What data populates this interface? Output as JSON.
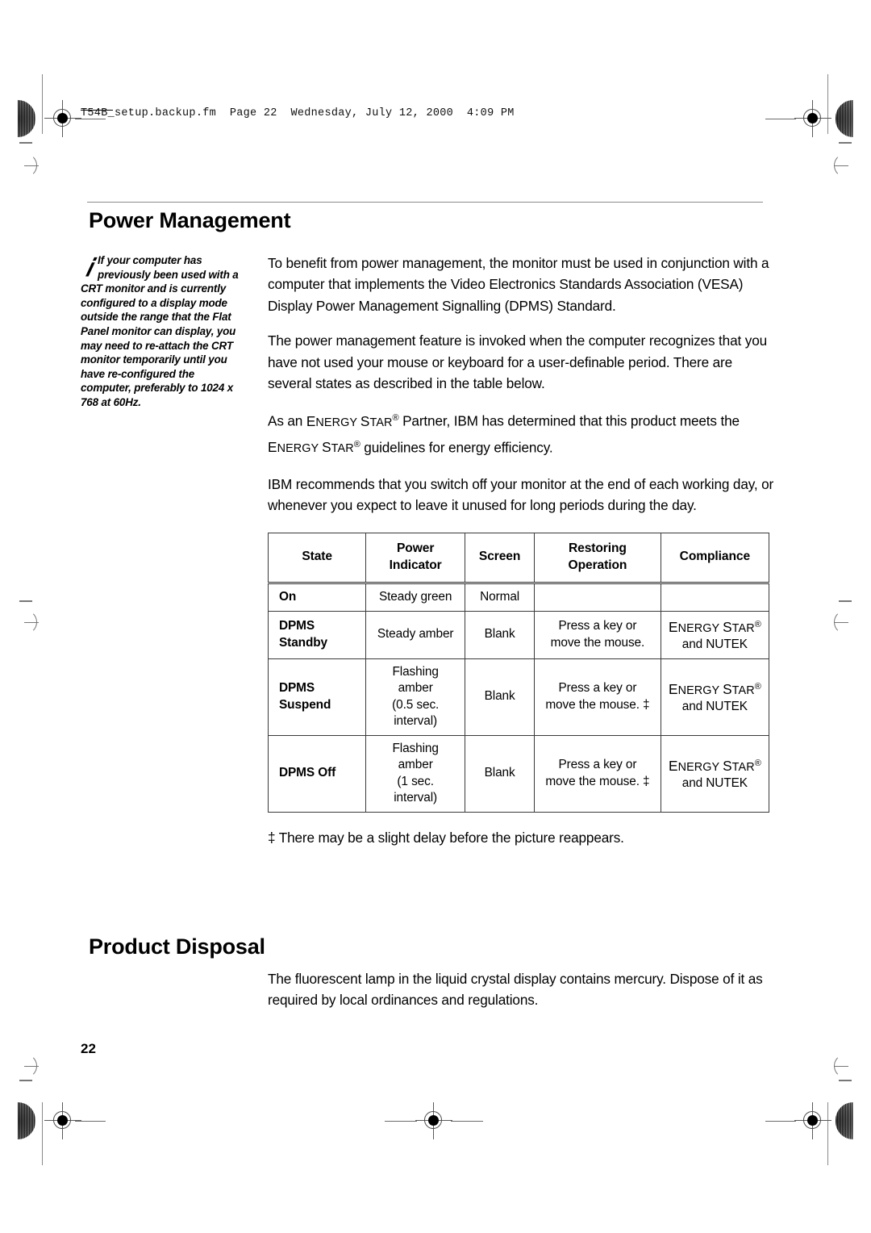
{
  "document": {
    "running_header": "T54B_setup.backup.fm  Page 22  Wednesday, July 12, 2000  4:09 PM",
    "page_number": "22"
  },
  "sections": {
    "power_management": {
      "title": "Power Management",
      "note": {
        "icon": "info-i-icon",
        "text": "If your computer has previously been used with a CRT monitor and is currently configured to a display mode outside the range that the Flat Panel monitor can display, you may need to re-attach the CRT monitor temporarily until you have re-configured the computer, preferably to 1024 x 768 at 60Hz."
      },
      "paragraphs": [
        "To benefit from power management, the monitor must be used in conjunction with a computer that implements the Video Electronics Standards Association (VESA) Display Power Management Signalling (DPMS) Standard.",
        "The power management feature is invoked when the computer recognizes that you have not used your mouse or keyboard for a user-definable period. There are several states as described in the table below."
      ],
      "energy_star_paragraph": {
        "lead": "As an ",
        "brand": "Energy Star",
        "mid": " Partner, IBM has determined that this product meets the ",
        "brand2": "Energy Star",
        "tail": " guidelines for energy efficiency."
      },
      "closing_paragraph": "IBM recommends that you switch off your monitor at the end of each working day, or whenever you expect to leave it unused for long periods during the day.",
      "footnote": "‡ There may be a slight delay before the picture reappears."
    },
    "product_disposal": {
      "title": "Product Disposal",
      "paragraph": "The fluorescent lamp in the liquid crystal display contains mercury. Dispose of it as required by local ordinances and regulations."
    }
  },
  "power_table": {
    "headers": [
      "State",
      "Power Indicator",
      "Screen",
      "Restoring Operation",
      "Compliance"
    ],
    "header_lines": [
      [
        "State"
      ],
      [
        "Power",
        "Indicator"
      ],
      [
        "Screen"
      ],
      [
        "Restoring",
        "Operation"
      ],
      [
        "Compliance"
      ]
    ],
    "rows": [
      {
        "state": "On",
        "power_indicator": [
          "Steady green"
        ],
        "screen": "Normal",
        "restoring_operation": [],
        "compliance": []
      },
      {
        "state": "DPMS Standby",
        "state_lines": [
          "DPMS",
          "Standby"
        ],
        "power_indicator": [
          "Steady amber"
        ],
        "screen": "Blank",
        "restoring_operation": [
          "Press a key or",
          "move the mouse."
        ],
        "compliance": [
          "Energy Star",
          "and NUTEK"
        ]
      },
      {
        "state": "DPMS Suspend",
        "state_lines": [
          "DPMS",
          "Suspend"
        ],
        "power_indicator": [
          "Flashing",
          "amber",
          "(0.5 sec.",
          "interval)"
        ],
        "screen": "Blank",
        "restoring_operation": [
          "Press a key or",
          "move the mouse. ‡"
        ],
        "compliance": [
          "Energy Star",
          "and NUTEK"
        ]
      },
      {
        "state": "DPMS Off",
        "state_lines": [
          "DPMS Off"
        ],
        "power_indicator": [
          "Flashing",
          "amber",
          "(1 sec.",
          "interval)"
        ],
        "screen": "Blank",
        "restoring_operation": [
          "Press a key or",
          "move the mouse. ‡"
        ],
        "compliance": [
          "Energy Star",
          "and NUTEK"
        ]
      }
    ]
  },
  "colors": {
    "page_background": "#ffffff",
    "text": "#000000",
    "rule": "#8d8d8d",
    "table_border": "#3a3a3a"
  }
}
